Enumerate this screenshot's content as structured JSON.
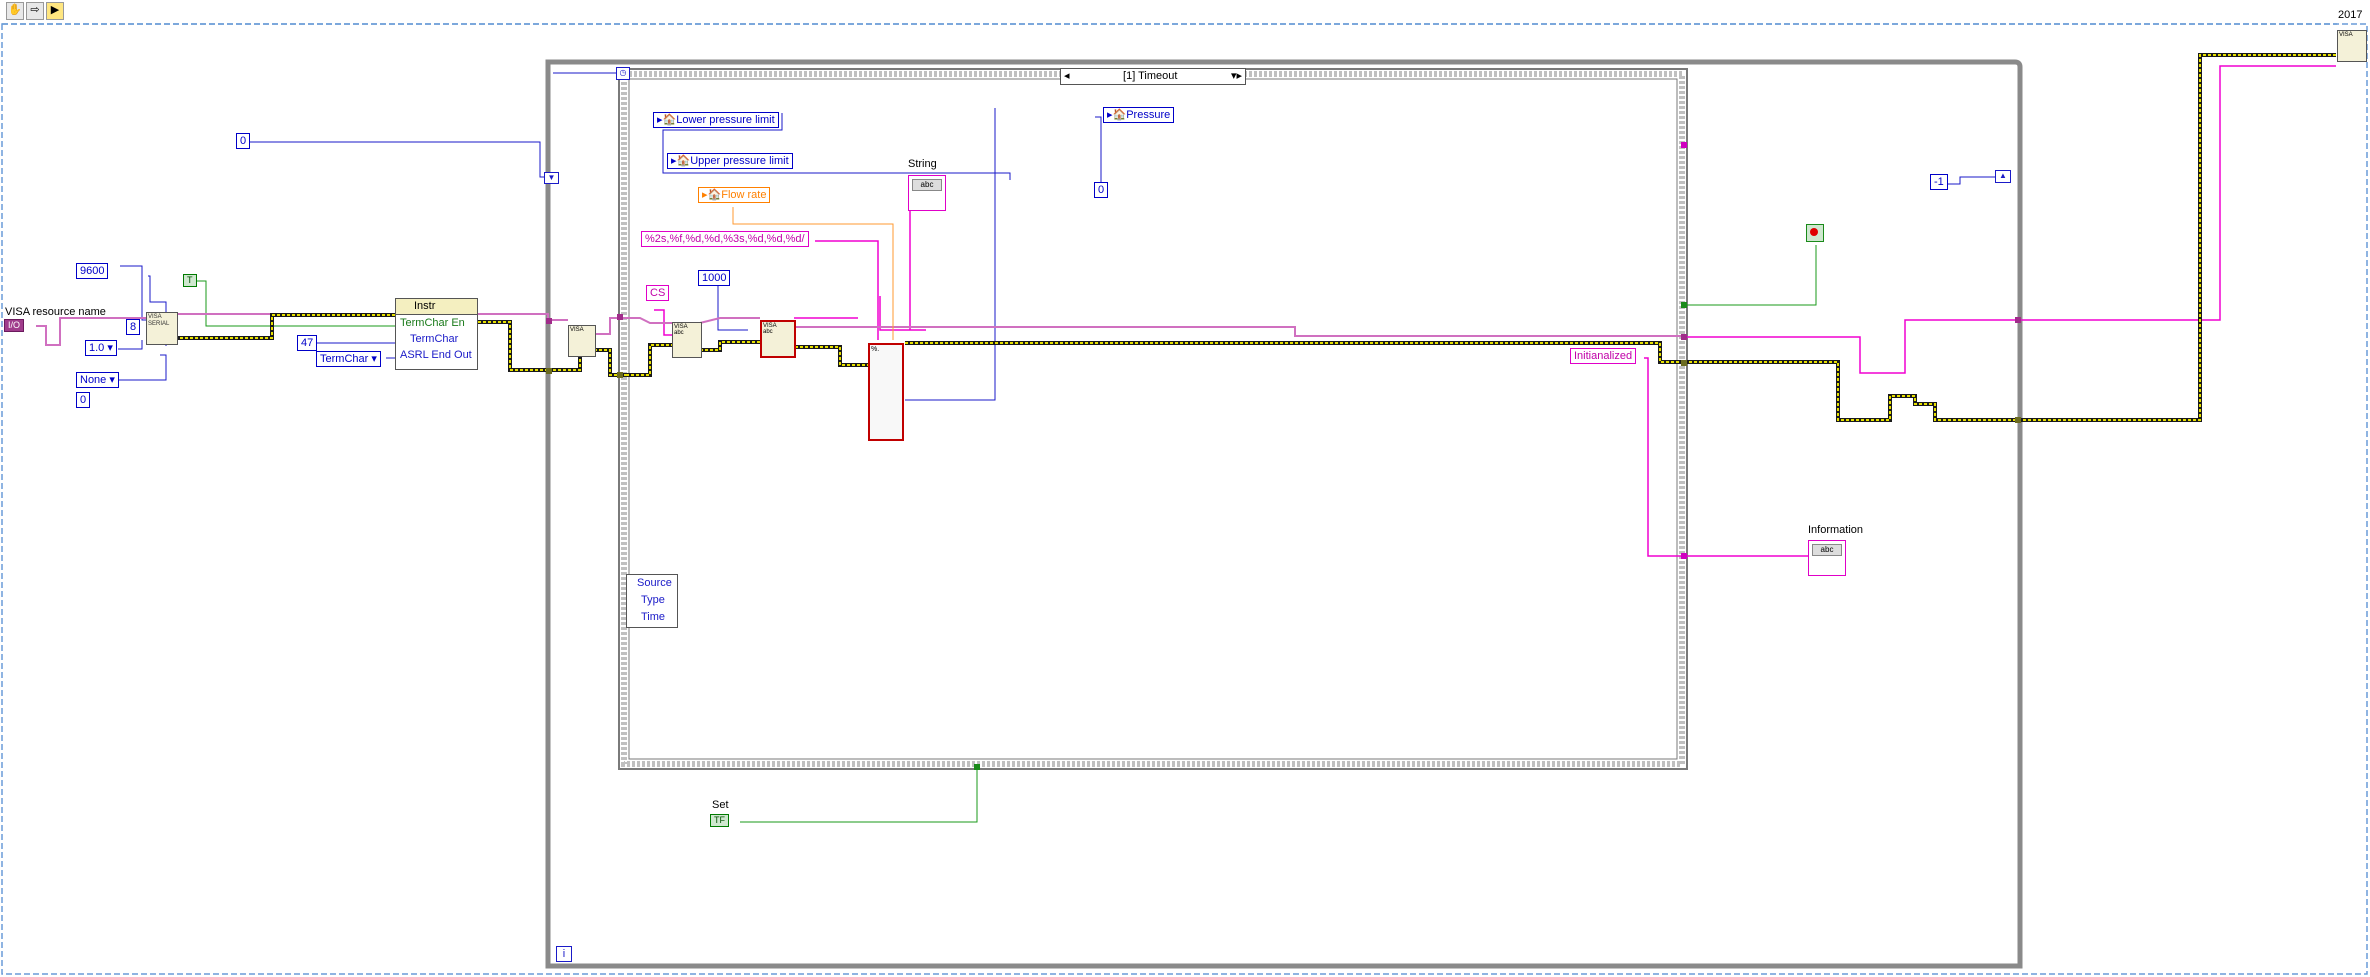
{
  "toolbar": {
    "icons": [
      "hand-icon",
      "arrow-right-icon",
      "run-arrow-icon"
    ]
  },
  "corner_label": "2017",
  "controls": {
    "visa_resource_name": "VISA resource name",
    "visa_ref": "I/O",
    "baud": "9600",
    "data_bits": "8",
    "stop_bits": "1.0",
    "parity": "None",
    "flow": "0",
    "bool_const": "T",
    "term_char": "47",
    "term_char_ring": "TermChar",
    "zero_const": "0",
    "neg_one": "-1",
    "set_label": "Set",
    "set_value": "TF"
  },
  "property_node": {
    "class": "Instr",
    "rows": [
      "TermChar En",
      "TermChar",
      "ASRL End Out"
    ]
  },
  "case_structure": {
    "selector": "[1] Timeout"
  },
  "inner": {
    "lower": "Lower pressure limit",
    "upper": "Upper pressure limit",
    "flow_rate": "Flow rate",
    "pressure": "Pressure",
    "pressure_zero": "0",
    "string_label": "String",
    "format": "%2s,%f,%d,%d,%3s,%d,%d,%d/",
    "cs": "CS",
    "timeout_ms": "1000",
    "initialized": "Initianalized",
    "information": "Information",
    "event_rows": [
      "Source",
      "Type",
      "Time"
    ]
  },
  "indicators": {
    "abc": "abc"
  },
  "loop_iter": "i",
  "colors": {
    "visa": "#7b2c6e",
    "error": "#d8c800",
    "string": "#ff00dc",
    "numeric": "#0000c8",
    "boolean": "#008000",
    "orange": "#ff8000"
  }
}
